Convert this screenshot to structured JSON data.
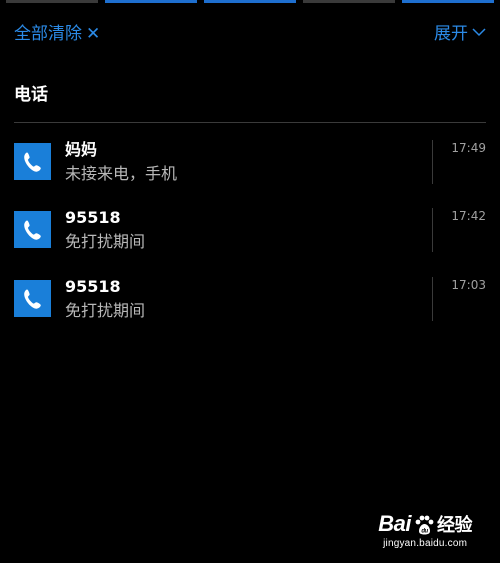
{
  "colors": {
    "accent": "#2b8ae6",
    "icon_bg": "#1a7fd9",
    "tile_dark": "#3a3a3a",
    "tile_blue": "#1e6fcf",
    "background": "#000000"
  },
  "header": {
    "clear_all_label": "全部清除",
    "clear_all_icon": "close-icon",
    "expand_label": "展开",
    "expand_icon": "chevron-down-icon"
  },
  "group": {
    "title": "电话",
    "app_icon": "phone-icon",
    "notifications": [
      {
        "title": "妈妈",
        "body": "未接来电，手机",
        "time": "17:49"
      },
      {
        "title": "95518",
        "body": "免打扰期间",
        "time": "17:42"
      },
      {
        "title": "95518",
        "body": "免打扰期间",
        "time": "17:03"
      }
    ]
  },
  "watermark": {
    "logo_prefix": "Bai",
    "logo_suffix": "经验",
    "url": "jingyan.baidu.com"
  }
}
